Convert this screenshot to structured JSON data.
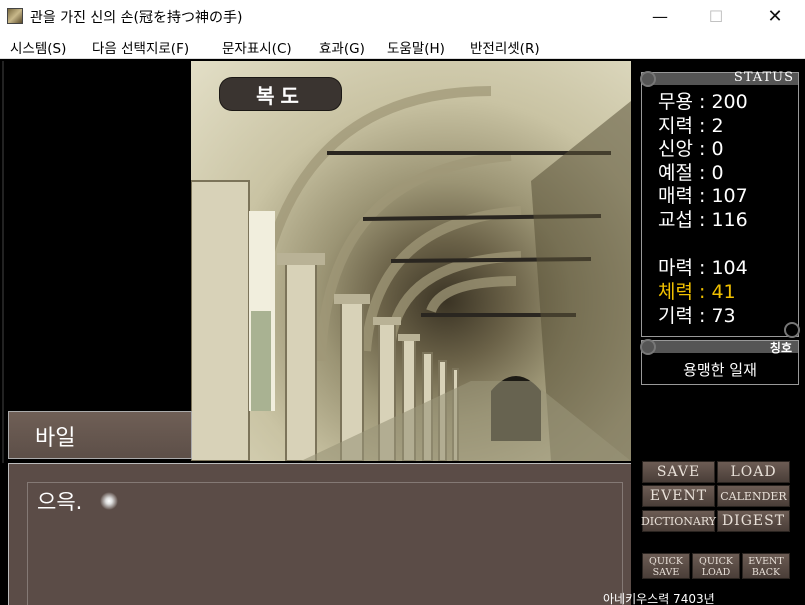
{
  "window": {
    "title": "관을 가진 신의 손(冠を持つ神の手)",
    "minimize": "—",
    "maximize": "☐",
    "close": "✕"
  },
  "menu": [
    "시스템(S)",
    "다음 선택지로(F)",
    "문자표시(C)",
    "효과(G)",
    "도움말(H)",
    "반전리셋(R)"
  ],
  "scene": {
    "location": "복도"
  },
  "dialog": {
    "speaker": "바일",
    "text": "으윽."
  },
  "status": {
    "title": "STATUS",
    "stats": [
      {
        "label": "무용 : 200",
        "highlight": false
      },
      {
        "label": "지력 : 2",
        "highlight": false
      },
      {
        "label": "신앙 : 0",
        "highlight": false
      },
      {
        "label": "예절 : 0",
        "highlight": false
      },
      {
        "label": "매력 : 107",
        "highlight": false
      },
      {
        "label": "교섭 : 116",
        "highlight": false
      },
      {
        "label": "마력 : 104",
        "highlight": false
      },
      {
        "label": "체력 : 41",
        "highlight": true
      },
      {
        "label": "기력 : 73",
        "highlight": false
      }
    ],
    "highlight_color": "#f0c000"
  },
  "title_panel": {
    "label": "칭호",
    "value": "용맹한 일재"
  },
  "buttons": {
    "save": "SAVE",
    "load": "LOAD",
    "event": "EVENT",
    "calender": "CALENDER",
    "dictionary": "DICTIONARY",
    "digest": "DIGEST",
    "quick_save": "QUICK SAVE",
    "quick_load": "QUICK LOAD",
    "event_back": "EVENT BACK"
  },
  "date": "아네키우스력 7403년"
}
